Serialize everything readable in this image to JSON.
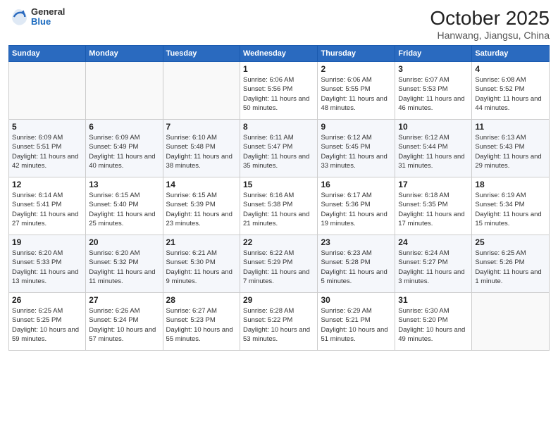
{
  "header": {
    "logo": {
      "general": "General",
      "blue": "Blue"
    },
    "title": "October 2025",
    "subtitle": "Hanwang, Jiangsu, China"
  },
  "days_of_week": [
    "Sunday",
    "Monday",
    "Tuesday",
    "Wednesday",
    "Thursday",
    "Friday",
    "Saturday"
  ],
  "weeks": [
    [
      {
        "day": "",
        "info": ""
      },
      {
        "day": "",
        "info": ""
      },
      {
        "day": "",
        "info": ""
      },
      {
        "day": "1",
        "info": "Sunrise: 6:06 AM\nSunset: 5:56 PM\nDaylight: 11 hours\nand 50 minutes."
      },
      {
        "day": "2",
        "info": "Sunrise: 6:06 AM\nSunset: 5:55 PM\nDaylight: 11 hours\nand 48 minutes."
      },
      {
        "day": "3",
        "info": "Sunrise: 6:07 AM\nSunset: 5:53 PM\nDaylight: 11 hours\nand 46 minutes."
      },
      {
        "day": "4",
        "info": "Sunrise: 6:08 AM\nSunset: 5:52 PM\nDaylight: 11 hours\nand 44 minutes."
      }
    ],
    [
      {
        "day": "5",
        "info": "Sunrise: 6:09 AM\nSunset: 5:51 PM\nDaylight: 11 hours\nand 42 minutes."
      },
      {
        "day": "6",
        "info": "Sunrise: 6:09 AM\nSunset: 5:49 PM\nDaylight: 11 hours\nand 40 minutes."
      },
      {
        "day": "7",
        "info": "Sunrise: 6:10 AM\nSunset: 5:48 PM\nDaylight: 11 hours\nand 38 minutes."
      },
      {
        "day": "8",
        "info": "Sunrise: 6:11 AM\nSunset: 5:47 PM\nDaylight: 11 hours\nand 35 minutes."
      },
      {
        "day": "9",
        "info": "Sunrise: 6:12 AM\nSunset: 5:45 PM\nDaylight: 11 hours\nand 33 minutes."
      },
      {
        "day": "10",
        "info": "Sunrise: 6:12 AM\nSunset: 5:44 PM\nDaylight: 11 hours\nand 31 minutes."
      },
      {
        "day": "11",
        "info": "Sunrise: 6:13 AM\nSunset: 5:43 PM\nDaylight: 11 hours\nand 29 minutes."
      }
    ],
    [
      {
        "day": "12",
        "info": "Sunrise: 6:14 AM\nSunset: 5:41 PM\nDaylight: 11 hours\nand 27 minutes."
      },
      {
        "day": "13",
        "info": "Sunrise: 6:15 AM\nSunset: 5:40 PM\nDaylight: 11 hours\nand 25 minutes."
      },
      {
        "day": "14",
        "info": "Sunrise: 6:15 AM\nSunset: 5:39 PM\nDaylight: 11 hours\nand 23 minutes."
      },
      {
        "day": "15",
        "info": "Sunrise: 6:16 AM\nSunset: 5:38 PM\nDaylight: 11 hours\nand 21 minutes."
      },
      {
        "day": "16",
        "info": "Sunrise: 6:17 AM\nSunset: 5:36 PM\nDaylight: 11 hours\nand 19 minutes."
      },
      {
        "day": "17",
        "info": "Sunrise: 6:18 AM\nSunset: 5:35 PM\nDaylight: 11 hours\nand 17 minutes."
      },
      {
        "day": "18",
        "info": "Sunrise: 6:19 AM\nSunset: 5:34 PM\nDaylight: 11 hours\nand 15 minutes."
      }
    ],
    [
      {
        "day": "19",
        "info": "Sunrise: 6:20 AM\nSunset: 5:33 PM\nDaylight: 11 hours\nand 13 minutes."
      },
      {
        "day": "20",
        "info": "Sunrise: 6:20 AM\nSunset: 5:32 PM\nDaylight: 11 hours\nand 11 minutes."
      },
      {
        "day": "21",
        "info": "Sunrise: 6:21 AM\nSunset: 5:30 PM\nDaylight: 11 hours\nand 9 minutes."
      },
      {
        "day": "22",
        "info": "Sunrise: 6:22 AM\nSunset: 5:29 PM\nDaylight: 11 hours\nand 7 minutes."
      },
      {
        "day": "23",
        "info": "Sunrise: 6:23 AM\nSunset: 5:28 PM\nDaylight: 11 hours\nand 5 minutes."
      },
      {
        "day": "24",
        "info": "Sunrise: 6:24 AM\nSunset: 5:27 PM\nDaylight: 11 hours\nand 3 minutes."
      },
      {
        "day": "25",
        "info": "Sunrise: 6:25 AM\nSunset: 5:26 PM\nDaylight: 11 hours\nand 1 minute."
      }
    ],
    [
      {
        "day": "26",
        "info": "Sunrise: 6:25 AM\nSunset: 5:25 PM\nDaylight: 10 hours\nand 59 minutes."
      },
      {
        "day": "27",
        "info": "Sunrise: 6:26 AM\nSunset: 5:24 PM\nDaylight: 10 hours\nand 57 minutes."
      },
      {
        "day": "28",
        "info": "Sunrise: 6:27 AM\nSunset: 5:23 PM\nDaylight: 10 hours\nand 55 minutes."
      },
      {
        "day": "29",
        "info": "Sunrise: 6:28 AM\nSunset: 5:22 PM\nDaylight: 10 hours\nand 53 minutes."
      },
      {
        "day": "30",
        "info": "Sunrise: 6:29 AM\nSunset: 5:21 PM\nDaylight: 10 hours\nand 51 minutes."
      },
      {
        "day": "31",
        "info": "Sunrise: 6:30 AM\nSunset: 5:20 PM\nDaylight: 10 hours\nand 49 minutes."
      },
      {
        "day": "",
        "info": ""
      }
    ]
  ]
}
